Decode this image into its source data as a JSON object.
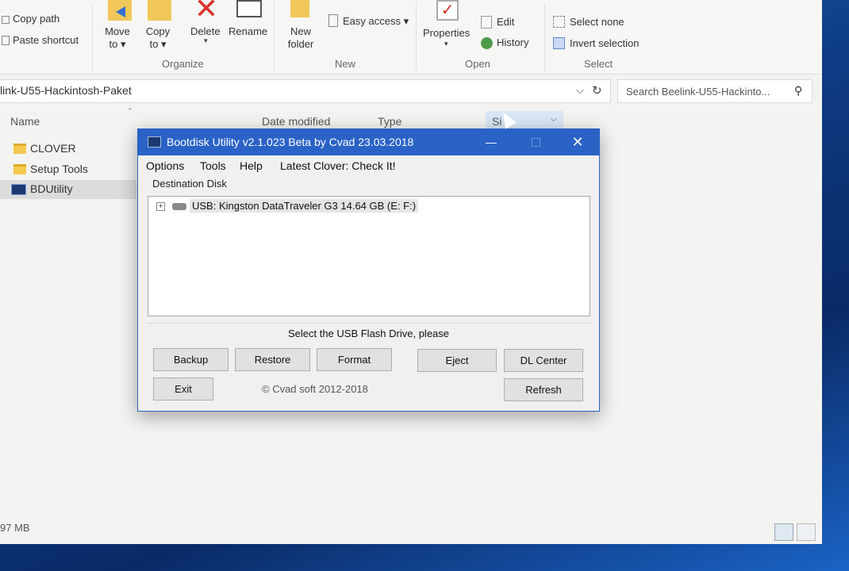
{
  "ribbon": {
    "clipboard": {
      "copy_path": "Copy path",
      "paste_shortcut": "Paste shortcut"
    },
    "organize": {
      "move_to": "Move to ▾",
      "copy_to": "Copy to ▾",
      "delete": "Delete",
      "rename": "Rename",
      "group": "Organize"
    },
    "new": {
      "new_folder": "New folder",
      "easy_access": "Easy access ▾",
      "group": "New"
    },
    "open": {
      "properties": "Properties",
      "edit": "Edit",
      "history": "History",
      "group": "Open"
    },
    "select": {
      "select_none": "Select none",
      "invert_selection": "Invert selection",
      "group": "Select"
    }
  },
  "address": {
    "path": "link-U55-Hackintosh-Paket",
    "search_placeholder": "Search Beelink-U55-Hackinto..."
  },
  "file_list": {
    "columns": {
      "name": "Name",
      "date_modified": "Date modified",
      "type": "Type",
      "size": "Si"
    },
    "items": [
      {
        "label": "CLOVER"
      },
      {
        "label": "Setup Tools"
      },
      {
        "label": "BDUtility"
      }
    ]
  },
  "status_bar": {
    "text": "97 MB"
  },
  "dialog": {
    "title": "Bootdisk Utility v2.1.023 Beta by Cvad 23.03.2018",
    "menu": {
      "options": "Options",
      "tools": "Tools",
      "help": "Help",
      "latest_clover": "Latest Clover: Check It!"
    },
    "destination_label": "Destination Disk",
    "tree_toggle": "+",
    "drive": "USB: Kingston DataTraveler G3 14.64 GB (E: F:)",
    "status": "Select the USB Flash Drive, please",
    "buttons": {
      "backup": "Backup",
      "restore": "Restore",
      "format": "Format",
      "eject": "Eject",
      "dl_center": "DL Center",
      "exit": "Exit",
      "refresh": "Refresh"
    },
    "copyright": "© Cvad soft 2012-2018",
    "close": "✕",
    "minimize": "—"
  },
  "colors": {
    "title_bar": "#2a62c6",
    "delete_red": "#d9312b",
    "folder_yellow": "#f5c94e"
  }
}
